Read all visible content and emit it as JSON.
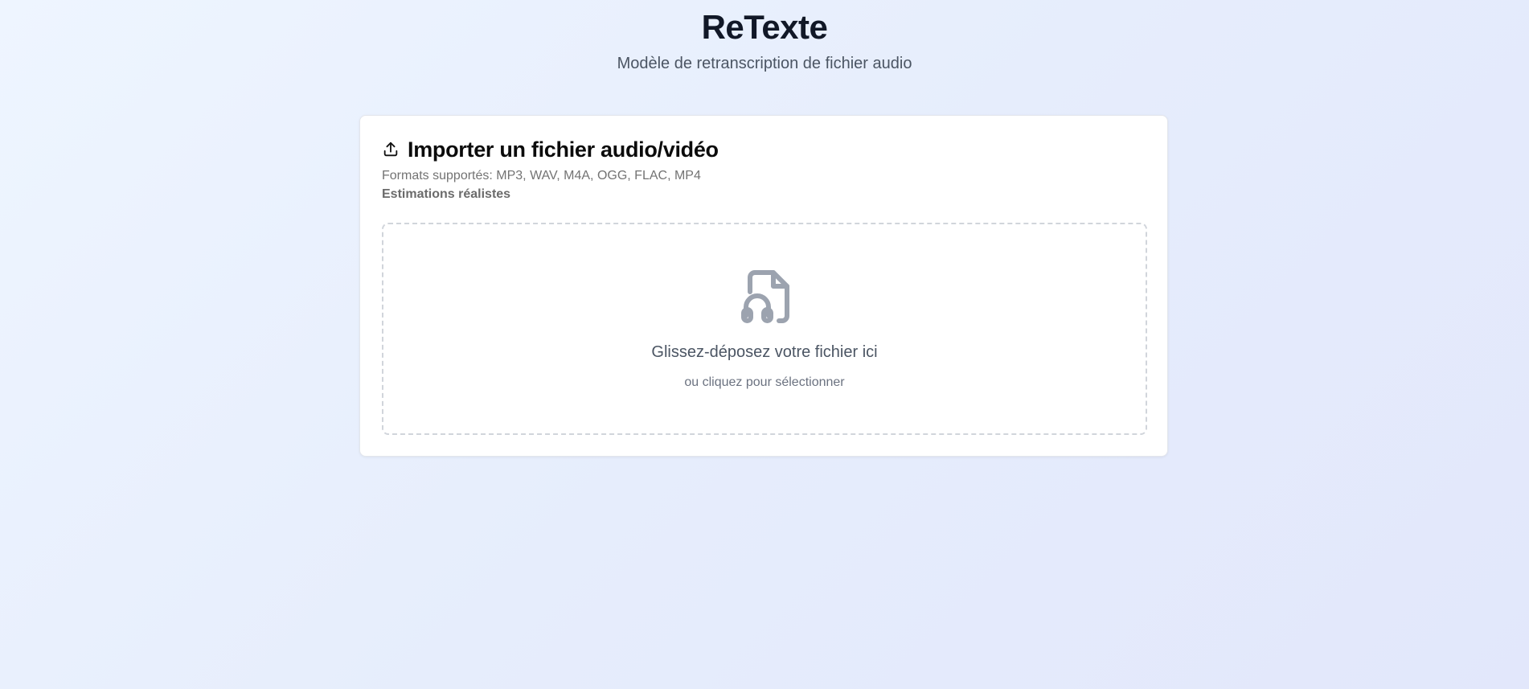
{
  "header": {
    "title": "ReTexte",
    "subtitle": "Modèle de retranscription de fichier audio"
  },
  "upload_card": {
    "title": "Importer un fichier audio/vidéo",
    "title_icon": "upload-icon",
    "formats": "Formats supportés: MP3, WAV, M4A, OGG, FLAC, MP4",
    "note": "Estimations réalistes",
    "dropzone": {
      "icon": "file-audio-icon",
      "primary_text": "Glissez-déposez votre fichier ici",
      "secondary_text": "ou cliquez pour sélectionner"
    }
  },
  "colors": {
    "background_start": "#eef5ff",
    "background_end": "#e2e7fb",
    "card": "#ffffff",
    "title": "#111827",
    "muted": "#4b5563",
    "icon": "#9ca3af",
    "dashed_border": "#d1d5db"
  }
}
